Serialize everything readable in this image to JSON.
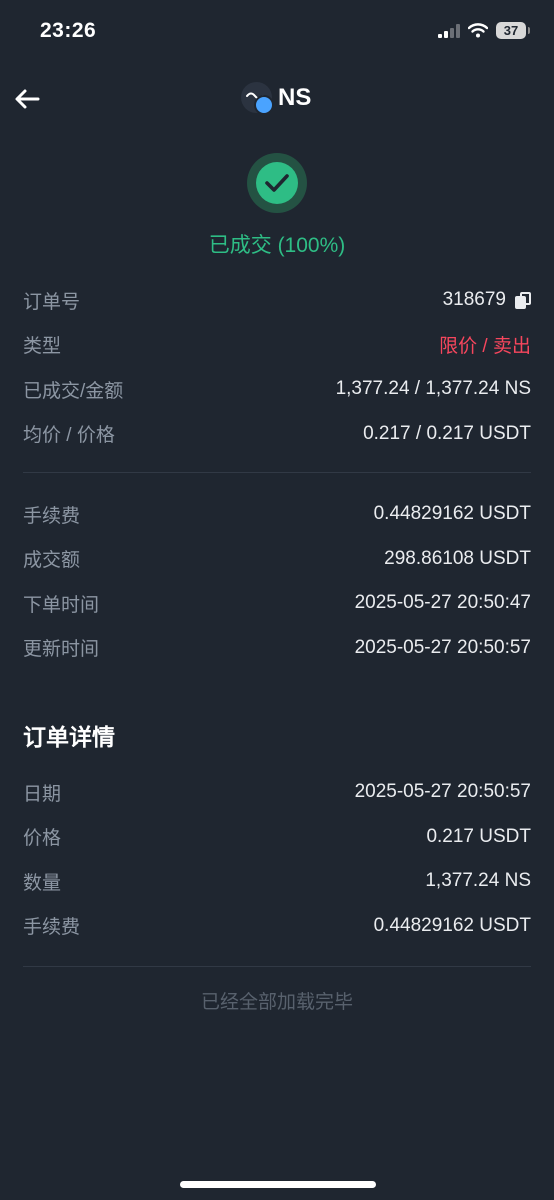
{
  "status_bar": {
    "time": "23:26",
    "battery": "37"
  },
  "header": {
    "back_label": "back",
    "title": "NS"
  },
  "order_status": {
    "text": "已成交 (100%)",
    "color": "#2ebd85"
  },
  "summary_rows": [
    {
      "label": "订单号",
      "value": "318679"
    },
    {
      "label": "类型",
      "value": "限价 / 卖出"
    },
    {
      "label": "已成交/金额",
      "value": "1,377.24 / 1,377.24 NS"
    },
    {
      "label": "均价 / 价格",
      "value": "0.217 / 0.217 USDT"
    }
  ],
  "fee_rows": [
    {
      "label": "手续费",
      "value": "0.44829162 USDT"
    },
    {
      "label": "成交额",
      "value": "298.86108 USDT"
    },
    {
      "label": "下单时间",
      "value": "2025-05-27 20:50:47"
    },
    {
      "label": "更新时间",
      "value": "2025-05-27 20:50:57"
    }
  ],
  "details": {
    "title": "订单详情",
    "rows": [
      {
        "label": "日期",
        "value": "2025-05-27 20:50:57"
      },
      {
        "label": "价格",
        "value": "0.217 USDT"
      },
      {
        "label": "数量",
        "value": "1,377.24 NS"
      },
      {
        "label": "手续费",
        "value": "0.44829162 USDT"
      }
    ]
  },
  "footer": {
    "load_complete": "已经全部加载完毕"
  },
  "colors": {
    "background": "#1f2630",
    "success": "#2ebd85",
    "sell": "#f6465d",
    "label": "#8c96a3"
  },
  "icons": [
    "back-arrow-icon",
    "ns-coin-logo",
    "checkmark-icon",
    "copy-icon",
    "signal-icon",
    "wifi-icon",
    "battery-icon"
  ]
}
